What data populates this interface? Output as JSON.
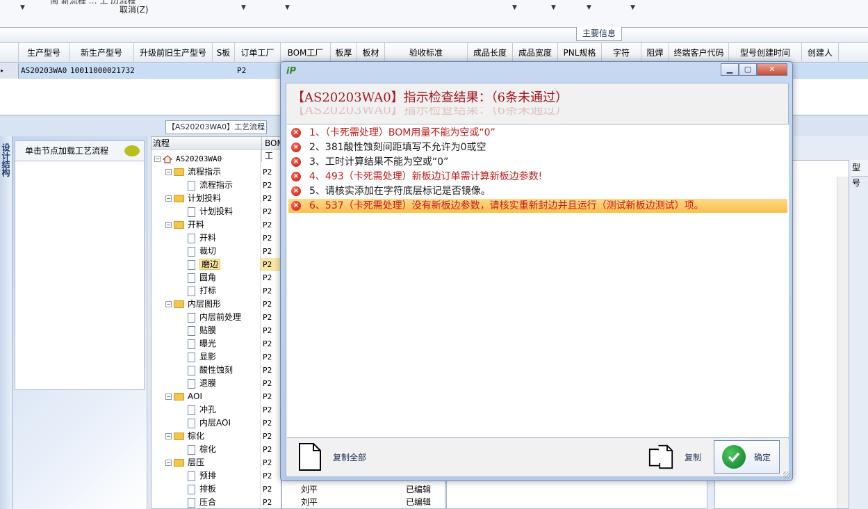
{
  "toolbar": {
    "cancel_label": "取消(Z)",
    "cut_text": "简  新流程 … 上 历流程"
  },
  "main_info_tab": "主要信息",
  "grid": {
    "columns": [
      "生产型号",
      "新生产型号",
      "升级前旧生产型号",
      "S板",
      "订单工厂",
      "BOM工厂",
      "板厚",
      "板材",
      "验收标准",
      "成品长度",
      "成品宽度",
      "PNL规格",
      "字符",
      "阻焊",
      "终端客户代码",
      "型号创建时间",
      "创建人"
    ],
    "row": {
      "indicator": "▸",
      "model": "AS20203WA0",
      "new_model": "10011000021732",
      "order_factory": "P2"
    }
  },
  "left_panel": {
    "side_tab": "设计结构",
    "hint": "单击节点加载工艺流程"
  },
  "process_tab": "【AS20203WA0】工艺流程",
  "tree": {
    "col_flow": "流程",
    "col_bom": "BOM工",
    "root": "AS20203WA0",
    "nodes": [
      {
        "label": "流程指示",
        "type": "folder",
        "bom": "P2"
      },
      {
        "label": "流程指示",
        "type": "page",
        "bom": "P2"
      },
      {
        "label": "计划投料",
        "type": "folder",
        "bom": "P2"
      },
      {
        "label": "计划投料",
        "type": "page",
        "bom": "P2"
      },
      {
        "label": "开料",
        "type": "folder",
        "bom": "P2"
      },
      {
        "label": "开料",
        "type": "page",
        "bom": "P2"
      },
      {
        "label": "裁切",
        "type": "page",
        "bom": "P2"
      },
      {
        "label": "磨边",
        "type": "page",
        "bom": "P2",
        "selected": true
      },
      {
        "label": "圆角",
        "type": "page",
        "bom": "P2"
      },
      {
        "label": "打标",
        "type": "page",
        "bom": "P2"
      },
      {
        "label": "内层图形",
        "type": "folder",
        "bom": "P2"
      },
      {
        "label": "内层前处理",
        "type": "page",
        "bom": "P2"
      },
      {
        "label": "贴膜",
        "type": "page",
        "bom": "P2"
      },
      {
        "label": "曝光",
        "type": "page",
        "bom": "P2"
      },
      {
        "label": "显影",
        "type": "page",
        "bom": "P2"
      },
      {
        "label": "酸性蚀刻",
        "type": "page",
        "bom": "P2"
      },
      {
        "label": "退膜",
        "type": "page",
        "bom": "P2"
      },
      {
        "label": "AOI",
        "type": "folder",
        "bom": "P2"
      },
      {
        "label": "冲孔",
        "type": "page",
        "bom": "P2"
      },
      {
        "label": "内层AOI",
        "type": "page",
        "bom": "P2"
      },
      {
        "label": "棕化",
        "type": "folder",
        "bom": "P2"
      },
      {
        "label": "棕化",
        "type": "page",
        "bom": "P2"
      },
      {
        "label": "层压",
        "type": "folder",
        "bom": "P2"
      },
      {
        "label": "预排",
        "type": "page",
        "bom": "P2"
      },
      {
        "label": "排板",
        "type": "page",
        "bom": "P2"
      },
      {
        "label": "压合",
        "type": "page",
        "bom": "P2"
      }
    ]
  },
  "lower_rows": [
    {
      "name": "刘平",
      "status": "已编辑"
    },
    {
      "name": "刘平",
      "status": "已编辑"
    }
  ],
  "right_label": "型号",
  "dialog": {
    "title": "【AS20203WA0】指示检查结果：（6条未通过）",
    "items": [
      {
        "text": "1、（卡死需处理）BOM用量不能为空或“0”",
        "color": "red"
      },
      {
        "text": "2、381酸性蚀刻间距填写不允许为0或空",
        "color": "black"
      },
      {
        "text": "3、工时计算结果不能为空或“0”",
        "color": "black"
      },
      {
        "text": "4、493（卡死需处理）新板边订单需计算新板边参数!",
        "color": "red"
      },
      {
        "text": "5、请核实添加在字符底层标记是否镜像。",
        "color": "black"
      },
      {
        "text": "6、537（卡死需处理）没有新板边参数，请核实重新封边并且运行（测试新板边测试）项。",
        "color": "red",
        "selected": true
      }
    ],
    "copy_all_label": "复制全部",
    "copy_label": "复制",
    "ok_label": "确定"
  },
  "colors": {
    "heading_red": "#a3161b",
    "item_red": "#c21a1a",
    "selection": "#fbbf4c",
    "ok_green": "#127a2a"
  }
}
